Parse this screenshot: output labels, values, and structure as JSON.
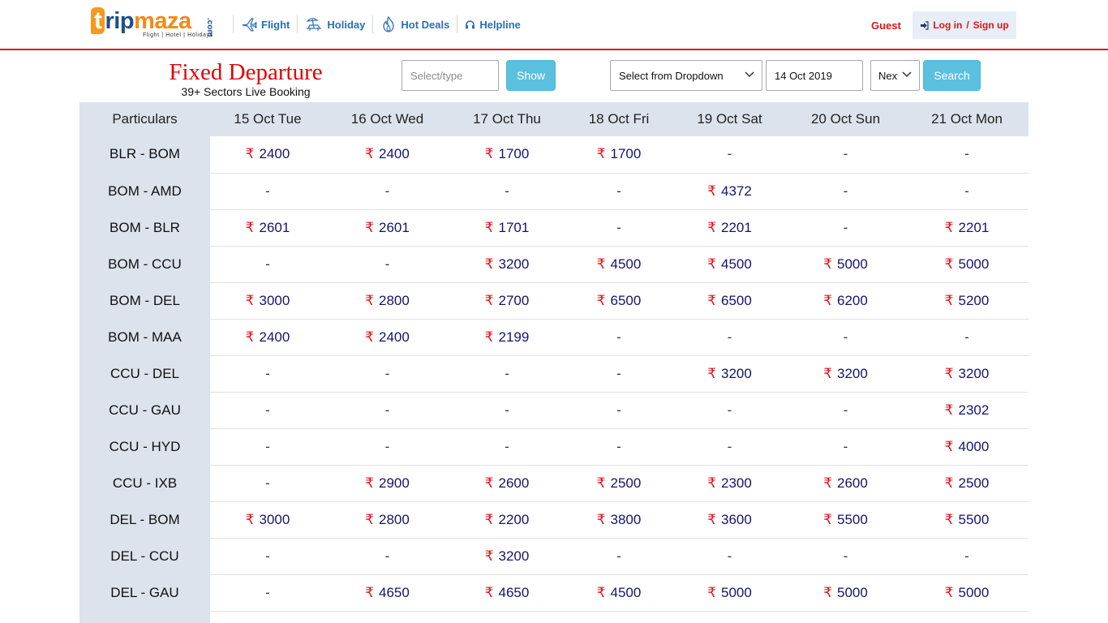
{
  "header": {
    "logo_text_t": "t",
    "logo_text_rip": "rip",
    "logo_text_maza": "maza",
    "logo_com": ".com",
    "logo_tagline": "Flight | Hotel | Holidays",
    "nav": [
      {
        "label": "Flight",
        "icon": "airplane-icon"
      },
      {
        "label": "Holiday",
        "icon": "beach-chair-icon"
      },
      {
        "label": "Hot Deals",
        "icon": "flame-icon"
      },
      {
        "label": "Helpline",
        "icon": "headset-icon"
      }
    ],
    "guest_label": "Guest",
    "login_label": "Log in",
    "login_separator": "/",
    "signup_label": "Sign up",
    "accent_color": "#e0151b",
    "link_color": "#2a6fb6"
  },
  "search": {
    "title": "Fixed Departure",
    "subtitle": "39+ Sectors Live Booking",
    "sector_placeholder": "Select/type",
    "show_label": "Show",
    "dropdown_value": "Select from Dropdown",
    "date_value": "14 Oct 2019",
    "range_value": "Next",
    "search_label": "Search",
    "button_color": "#5bc0de"
  },
  "table": {
    "currency_symbol": "₹",
    "headers": [
      "Particulars",
      "15 Oct Tue",
      "16 Oct Wed",
      "17 Oct Thu",
      "18 Oct Fri",
      "19 Oct Sat",
      "20 Oct Sun",
      "21 Oct Mon"
    ],
    "rows": [
      {
        "sector": "BLR - BOM",
        "fares": [
          "2400",
          "2400",
          "1700",
          "1700",
          "-",
          "-",
          "-"
        ]
      },
      {
        "sector": "BOM - AMD",
        "fares": [
          "-",
          "-",
          "-",
          "-",
          "4372",
          "-",
          "-"
        ]
      },
      {
        "sector": "BOM - BLR",
        "fares": [
          "2601",
          "2601",
          "1701",
          "-",
          "2201",
          "-",
          "2201"
        ]
      },
      {
        "sector": "BOM - CCU",
        "fares": [
          "-",
          "-",
          "3200",
          "4500",
          "4500",
          "5000",
          "5000"
        ]
      },
      {
        "sector": "BOM - DEL",
        "fares": [
          "3000",
          "2800",
          "2700",
          "6500",
          "6500",
          "6200",
          "5200"
        ]
      },
      {
        "sector": "BOM - MAA",
        "fares": [
          "2400",
          "2400",
          "2199",
          "-",
          "-",
          "-",
          "-"
        ]
      },
      {
        "sector": "CCU - DEL",
        "fares": [
          "-",
          "-",
          "-",
          "-",
          "3200",
          "3200",
          "3200"
        ]
      },
      {
        "sector": "CCU - GAU",
        "fares": [
          "-",
          "-",
          "-",
          "-",
          "-",
          "-",
          "2302"
        ]
      },
      {
        "sector": "CCU - HYD",
        "fares": [
          "-",
          "-",
          "-",
          "-",
          "-",
          "-",
          "4000"
        ]
      },
      {
        "sector": "CCU - IXB",
        "fares": [
          "-",
          "2900",
          "2600",
          "2500",
          "2300",
          "2600",
          "2500"
        ]
      },
      {
        "sector": "DEL - BOM",
        "fares": [
          "3000",
          "2800",
          "2200",
          "3800",
          "3600",
          "5500",
          "5500"
        ]
      },
      {
        "sector": "DEL - CCU",
        "fares": [
          "-",
          "-",
          "3200",
          "-",
          "-",
          "-",
          "-"
        ]
      },
      {
        "sector": "DEL - GAU",
        "fares": [
          "-",
          "4650",
          "4650",
          "4500",
          "5000",
          "5000",
          "5000"
        ]
      },
      {
        "sector": "",
        "fares": [
          "",
          "",
          "",
          "",
          "",
          "",
          ""
        ]
      }
    ]
  }
}
